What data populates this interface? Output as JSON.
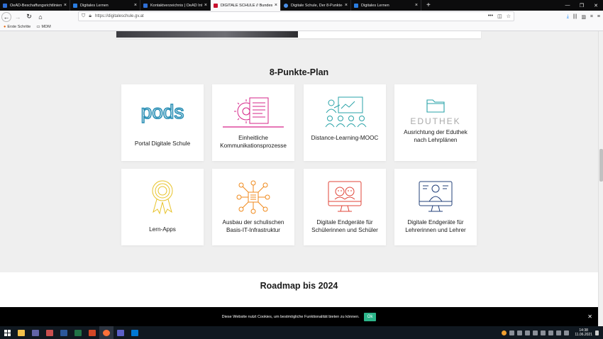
{
  "browser": {
    "tabs": [
      {
        "title": "OeAD-Beschaffungsrichtlinien",
        "color": "#2f6fd6",
        "active": false
      },
      {
        "title": "Digitales Lernen",
        "color": "#2a7de1",
        "active": false
      },
      {
        "title": "Kontaktverzeichnis | OeAD Int...",
        "color": "#2f6fd6",
        "active": false
      },
      {
        "title": "DIGITALE SCHULE // Bundesm...",
        "color": "#c8102e",
        "active": true
      },
      {
        "title": "Digitale Schule, Der 8-Punkte-P...",
        "color": "#4a8fe7",
        "active": false
      },
      {
        "title": "Digitales Lernen",
        "color": "#2a7de1",
        "active": false
      }
    ],
    "url": "https://digitaleschule.gv.at",
    "bookmarks": [
      {
        "label": "Erste Schritte",
        "icon": "firefox-icon"
      },
      {
        "label": "MDM",
        "icon": "folder-icon"
      }
    ]
  },
  "page": {
    "plan_title": "8-Punkte-Plan",
    "cards": [
      {
        "label": "Portal Digitale Schule",
        "icon": "pods-logo"
      },
      {
        "label": "Einheitliche Kommunikationsprozesse",
        "icon": "document-gear-icon"
      },
      {
        "label": "Distance-Learning-MOOC",
        "icon": "presentation-group-icon"
      },
      {
        "label": "Ausrichtung der Eduthek nach Lehrplänen",
        "icon": "eduthek-folder-icon",
        "logo_text": "EDUTHEK"
      },
      {
        "label": "Lern-Apps",
        "icon": "award-ribbon-icon"
      },
      {
        "label": "Ausbau der schulischen Basis-IT-Infrastruktur",
        "icon": "network-chip-icon"
      },
      {
        "label": "Digitale Endgeräte für Schülerinnen und Schüler",
        "icon": "monitor-students-icon"
      },
      {
        "label": "Digitale Endgeräte für Lehrerinnen und Lehrer",
        "icon": "monitor-teacher-icon"
      }
    ],
    "roadmap_title": "Roadmap bis 2024",
    "pods_text": "pods"
  },
  "cookie": {
    "text": "Diese Website nutzt Cookies, um bestmögliche Funktionalität bieten zu können.",
    "ok_label": "Ok"
  },
  "taskbar": {
    "time": "14:38",
    "date": "11.06.2021"
  },
  "colors": {
    "pods_blue": "#2a8fb5",
    "magenta": "#d6258a",
    "teal": "#2aa3a8",
    "gold": "#e8c32a",
    "orange": "#f08a1c",
    "red": "#e0463a",
    "navy": "#23407a",
    "cookie_ok": "#2cb58a"
  }
}
